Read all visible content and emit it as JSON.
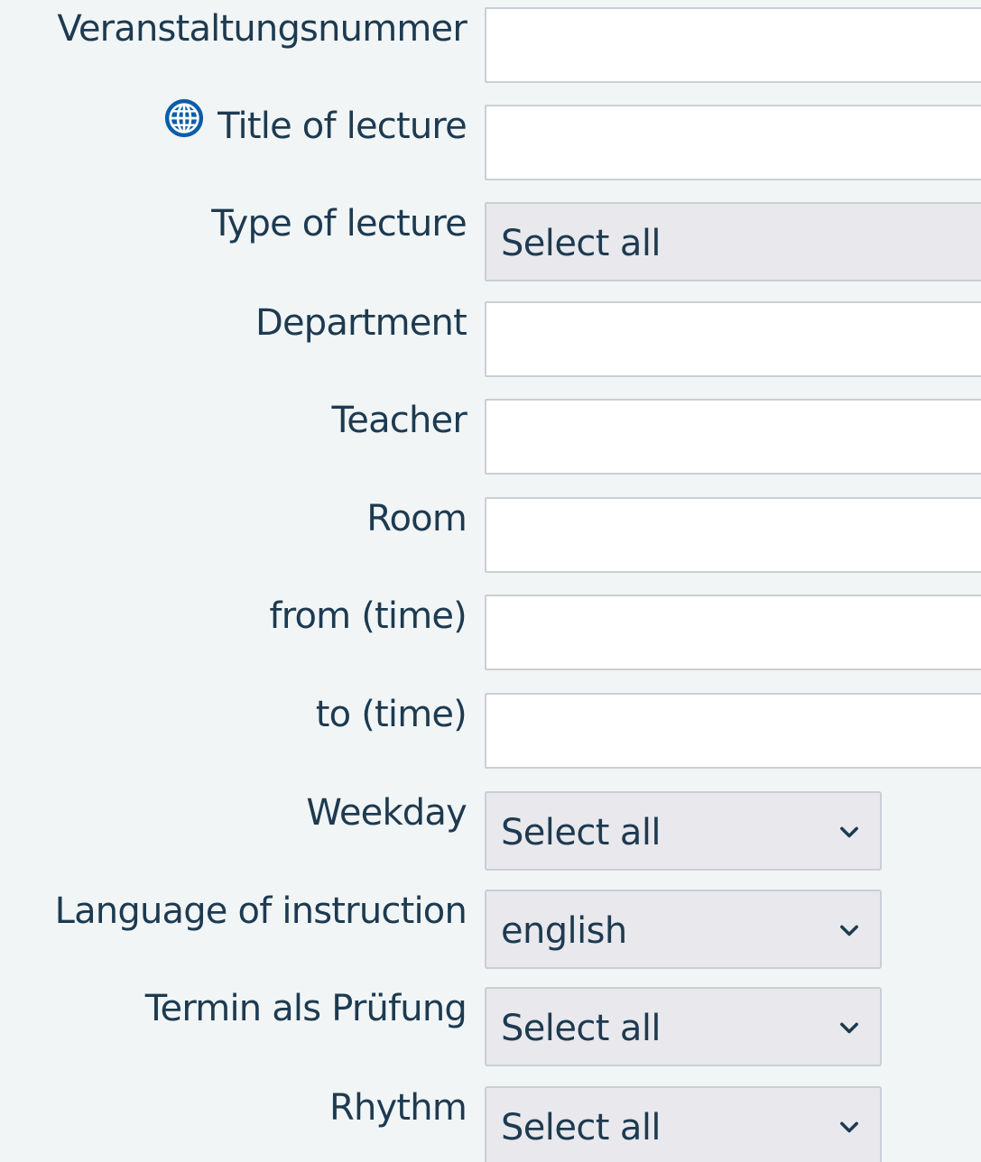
{
  "form": {
    "event_number": {
      "label": "Veranstaltungsnummer",
      "value": ""
    },
    "title": {
      "label": "Title of lecture",
      "value": "",
      "icon": "globe-icon"
    },
    "type": {
      "label": "Type of lecture",
      "value": "Select all"
    },
    "department": {
      "label": "Department",
      "value": ""
    },
    "teacher": {
      "label": "Teacher",
      "value": ""
    },
    "room": {
      "label": "Room",
      "value": ""
    },
    "from_time": {
      "label": "from (time)",
      "value": ""
    },
    "to_time": {
      "label": "to (time)",
      "value": ""
    },
    "weekday": {
      "label": "Weekday",
      "value": "Select all"
    },
    "language": {
      "label": "Language of instruction",
      "value": "english"
    },
    "exam": {
      "label": "Termin als Prüfung",
      "value": "Select all"
    },
    "rhythm": {
      "label": "Rhythm",
      "value": "Select all"
    }
  },
  "colors": {
    "background": "#f1f5f6",
    "text": "#1d3a50",
    "icon_blue": "#0a5da8",
    "select_bg": "#e8e8ed",
    "input_border": "#c9cfd4"
  }
}
